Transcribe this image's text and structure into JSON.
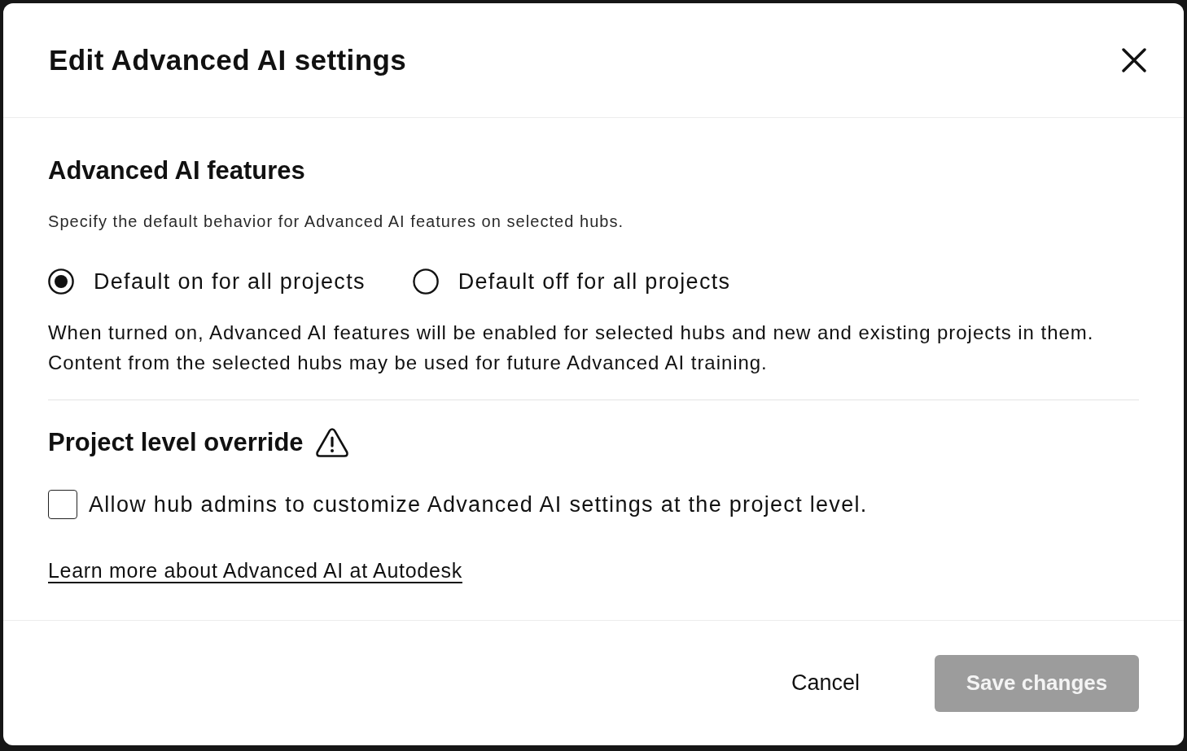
{
  "dialog": {
    "title": "Edit Advanced AI settings"
  },
  "advanced_ai_features": {
    "heading": "Advanced AI features",
    "description": "Specify the default behavior for Advanced AI features on selected hubs.",
    "options": [
      {
        "label": "Default on for all projects",
        "selected": true
      },
      {
        "label": "Default off for all projects",
        "selected": false
      }
    ],
    "note": "When turned on, Advanced AI features will be enabled for selected hubs and new and existing projects in them. Content from the selected hubs may be used for future Advanced AI training."
  },
  "project_level_override": {
    "heading": "Project level override",
    "checkbox": {
      "label": "Allow hub admins to customize Advanced AI settings at the project level.",
      "checked": false
    }
  },
  "link": "Learn more about Advanced AI at Autodesk",
  "footer": {
    "buttons": [
      {
        "label": "Cancel",
        "kind": "flat",
        "disabled": false
      },
      {
        "label": "Save changes",
        "kind": "filled",
        "disabled": true
      }
    ]
  }
}
